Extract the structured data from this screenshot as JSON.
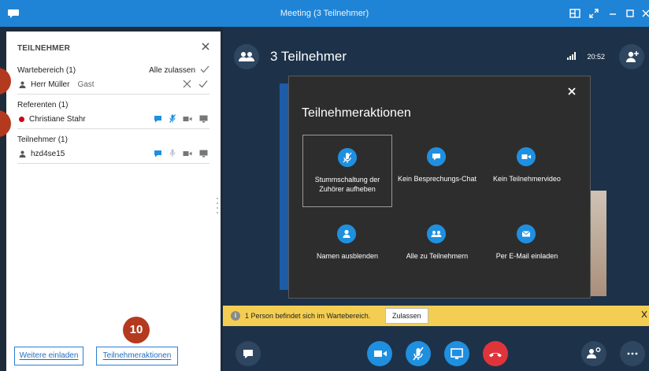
{
  "window": {
    "title": "Meeting (3 Teilnehmer)"
  },
  "participants_pane": {
    "heading": "TEILNEHMER",
    "lobby": {
      "label": "Wartebereich (1)",
      "admit_all": "Alle zulassen",
      "people": [
        {
          "name": "Herr Müller",
          "role": "Gast"
        }
      ]
    },
    "presenters": {
      "label": "Referenten (1)",
      "people": [
        {
          "name": "Christiane Stahr"
        }
      ]
    },
    "attendees": {
      "label": "Teilnehmer (1)",
      "people": [
        {
          "name": "hzd4se15"
        }
      ]
    },
    "invite_more_label": "Weitere einladen",
    "participant_actions_label": "Teilnehmeraktionen"
  },
  "callouts": {
    "badge_10": "10"
  },
  "stage": {
    "title": "3 Teilnehmer",
    "time": "20:52"
  },
  "modal": {
    "title": "Teilnehmeraktionen",
    "tiles": [
      {
        "label": "Stummschaltung der Zuhörer aufheben",
        "icon": "mic-off-icon"
      },
      {
        "label": "Kein Besprechungs-Chat",
        "icon": "chat-icon"
      },
      {
        "label": "Kein Teilnehmervideo",
        "icon": "video-icon"
      },
      {
        "label": "Namen ausblenden",
        "icon": "person-icon"
      },
      {
        "label": "Alle zu Teilnehmern",
        "icon": "group-icon"
      },
      {
        "label": "Per E-Mail einladen",
        "icon": "email-icon"
      }
    ]
  },
  "lobby_banner": {
    "message": "1 Person befindet sich im Wartebereich.",
    "admit_label": "Zulassen"
  },
  "colors": {
    "accent": "#1f84d6",
    "stage_bg": "#1d3249",
    "banner": "#f4ce52",
    "hangup": "#e0343b"
  }
}
